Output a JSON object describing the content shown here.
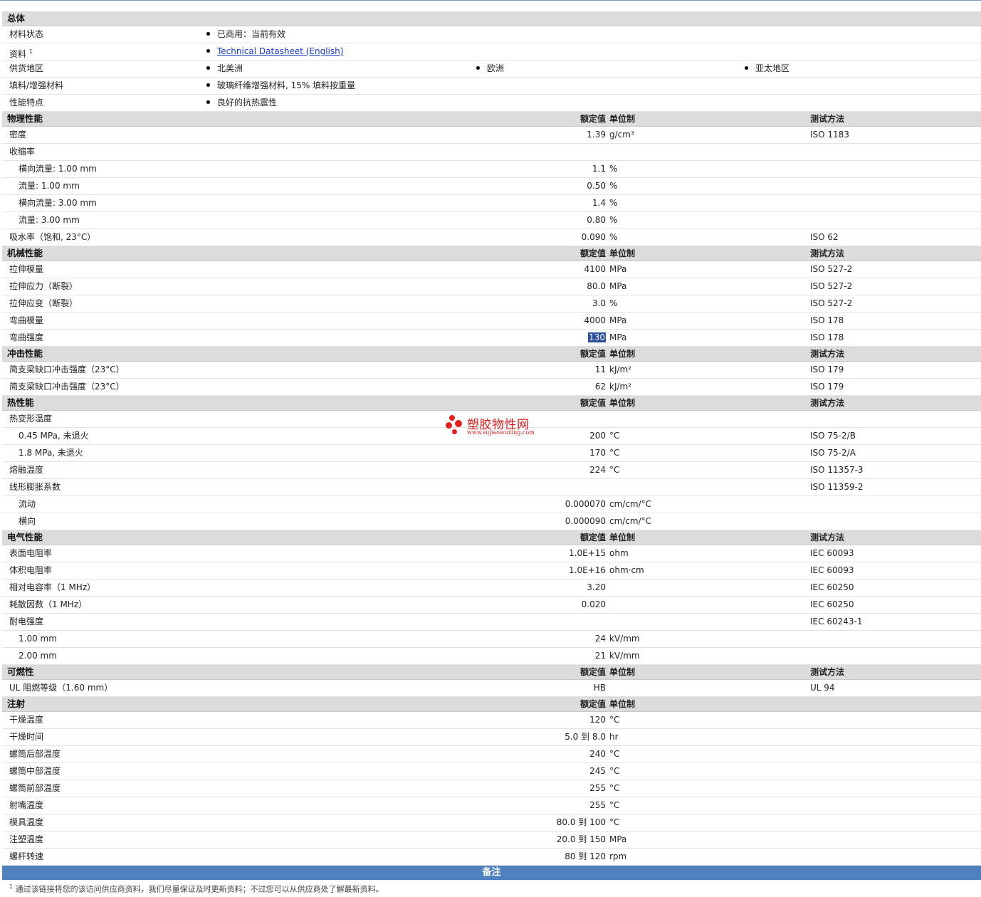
{
  "col_labels": {
    "value": "额定值",
    "unit": "单位制",
    "method": "测试方法"
  },
  "general": {
    "title": "总体",
    "rows": [
      {
        "name": "材料状态",
        "items": [
          "已商用：当前有效"
        ]
      },
      {
        "name": "资料",
        "sup": "1",
        "items": [
          "Technical Datasheet (English)"
        ],
        "link": true
      },
      {
        "name": "供货地区",
        "items": [
          "北美洲",
          "欧洲",
          "亚太地区"
        ]
      },
      {
        "name": "填料/增强材料",
        "items": [
          "玻璃纤维增强材料, 15% 填料按重量"
        ]
      },
      {
        "name": "性能特点",
        "items": [
          "良好的抗热震性"
        ]
      }
    ]
  },
  "sections": [
    {
      "title": "物理性能",
      "method_header": true,
      "rows": [
        {
          "name": "密度",
          "value": "1.39",
          "unit": "g/cm³",
          "method": "ISO 1183"
        },
        {
          "name": "收缩率"
        },
        {
          "name": "横向流量: 1.00 mm",
          "indent": true,
          "value": "1.1",
          "unit": "%"
        },
        {
          "name": "流量: 1.00 mm",
          "indent": true,
          "value": "0.50",
          "unit": "%"
        },
        {
          "name": "横向流量: 3.00 mm",
          "indent": true,
          "value": "1.4",
          "unit": "%"
        },
        {
          "name": "流量: 3.00 mm",
          "indent": true,
          "value": "0.80",
          "unit": "%"
        },
        {
          "name": "吸水率（饱和, 23°C）",
          "value": "0.090",
          "unit": "%",
          "method": "ISO 62"
        }
      ]
    },
    {
      "title": "机械性能",
      "method_header": true,
      "rows": [
        {
          "name": "拉伸模量",
          "value": "4100",
          "unit": "MPa",
          "method": "ISO 527-2"
        },
        {
          "name": "拉伸应力（断裂）",
          "value": "80.0",
          "unit": "MPa",
          "method": "ISO 527-2"
        },
        {
          "name": "拉伸应变（断裂）",
          "value": "3.0",
          "unit": "%",
          "method": "ISO 527-2"
        },
        {
          "name": "弯曲模量",
          "value": "4000",
          "unit": "MPa",
          "method": "ISO 178"
        },
        {
          "name": "弯曲强度",
          "value": "130",
          "unit": "MPa",
          "method": "ISO 178",
          "selected": true
        }
      ]
    },
    {
      "title": "冲击性能",
      "method_header": true,
      "rows": [
        {
          "name": "简支梁缺口冲击强度（23°C）",
          "value": "11",
          "unit": "kJ/m²",
          "method": "ISO 179"
        },
        {
          "name": "简支梁缺口冲击强度（23°C）",
          "value": "62",
          "unit": "kJ/m²",
          "method": "ISO 179"
        }
      ]
    },
    {
      "title": "热性能",
      "method_header": true,
      "rows": [
        {
          "name": "热变形温度"
        },
        {
          "name": "0.45 MPa, 未退火",
          "indent": true,
          "value": "200",
          "unit": "°C",
          "method": "ISO 75-2/B"
        },
        {
          "name": "1.8 MPa, 未退火",
          "indent": true,
          "value": "170",
          "unit": "°C",
          "method": "ISO 75-2/A"
        },
        {
          "name": "熔融温度",
          "value": "224",
          "unit": "°C",
          "method": "ISO 11357-3"
        },
        {
          "name": "线形膨胀系数",
          "method": "ISO 11359-2"
        },
        {
          "name": "流动",
          "indent": true,
          "value": "0.000070",
          "unit": "cm/cm/°C"
        },
        {
          "name": "横向",
          "indent": true,
          "value": "0.000090",
          "unit": "cm/cm/°C"
        }
      ]
    },
    {
      "title": "电气性能",
      "method_header": true,
      "rows": [
        {
          "name": "表面电阻率",
          "value": "1.0E+15",
          "unit": "ohm",
          "method": "IEC 60093"
        },
        {
          "name": "体积电阻率",
          "value": "1.0E+16",
          "unit": "ohm·cm",
          "method": "IEC 60093"
        },
        {
          "name": "相对电容率（1 MHz）",
          "value": "3.20",
          "method": "IEC 60250"
        },
        {
          "name": "耗散因数（1 MHz）",
          "value": "0.020",
          "method": "IEC 60250"
        },
        {
          "name": "耐电强度",
          "method": "IEC 60243-1"
        },
        {
          "name": "1.00 mm",
          "indent": true,
          "value": "24",
          "unit": "kV/mm"
        },
        {
          "name": "2.00 mm",
          "indent": true,
          "value": "21",
          "unit": "kV/mm"
        }
      ]
    },
    {
      "title": "可燃性",
      "method_header": true,
      "rows": [
        {
          "name": "UL 阻燃等级（1.60 mm）",
          "value": "HB",
          "method": "UL 94"
        }
      ]
    },
    {
      "title": "注射",
      "method_header": false,
      "rows": [
        {
          "name": "干燥温度",
          "value": "120",
          "unit": "°C"
        },
        {
          "name": "干燥时间",
          "value": "5.0 到  8.0",
          "unit": "hr"
        },
        {
          "name": "螺筒后部温度",
          "value": "240",
          "unit": "°C"
        },
        {
          "name": "螺筒中部温度",
          "value": "245",
          "unit": "°C"
        },
        {
          "name": "螺筒前部温度",
          "value": "255",
          "unit": "°C"
        },
        {
          "name": "射嘴温度",
          "value": "255",
          "unit": "°C"
        },
        {
          "name": "模具温度",
          "value": "80.0 到  100",
          "unit": "°C"
        },
        {
          "name": "注塑温度",
          "value": "20.0 到  150",
          "unit": "MPa"
        },
        {
          "name": "螺杆转速",
          "value": "80 到  120",
          "unit": "rpm"
        }
      ]
    }
  ],
  "notes": {
    "title": "备注",
    "footnote_mark": "1",
    "footnote": "通过该链接将您的该访问供应商资料，我们尽量保证及时更新资料；不过您可以从供应商处了解最新资料。"
  },
  "watermark": {
    "name": "塑胶物性网",
    "url": "www.sujiaowuxing.com"
  }
}
